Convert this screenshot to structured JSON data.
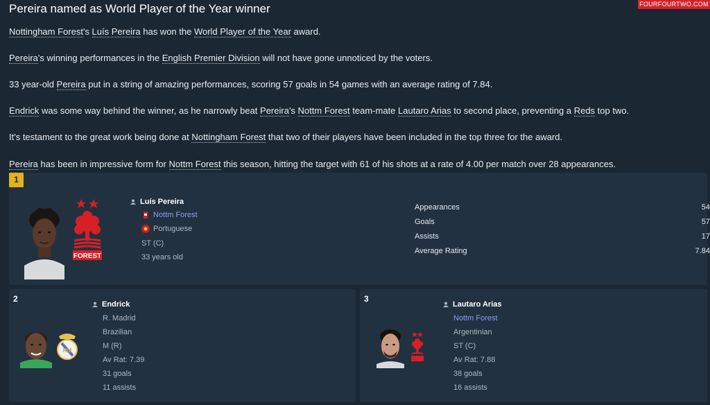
{
  "source": "FOURFOURTWO.COM",
  "headline": "Pereira named as World Player of the Year winner",
  "paragraphs": {
    "p1": {
      "a": "Nottingham Forest",
      "b": "'s ",
      "c": "Luís Pereira",
      "d": " has won the ",
      "e": "World Player of the Year",
      "f": " award."
    },
    "p2": {
      "a": "Pereira",
      "b": "'s winning performances in the ",
      "c": "English Premier Division",
      "d": " will not have gone unnoticed by the voters."
    },
    "p3": {
      "a": "33 year-old ",
      "b": "Pereira",
      "c": " put in a string of amazing performances, scoring 57 goals in 54 games with an average rating of 7.84."
    },
    "p4": {
      "a": "Endrick",
      "b": " was some way behind the winner, as he narrowly beat ",
      "c": "Pereira",
      "d": "'s ",
      "e": "Nottm Forest",
      "f": " team-mate ",
      "g": "Lautaro Arias",
      "h": " to second place, preventing a ",
      "i": "Reds",
      "j": " top two."
    },
    "p5": {
      "a": "It's testament to the great work being done at ",
      "b": "Nottingham Forest",
      "c": " that two of their players have been included in the top three for the award."
    },
    "p6": {
      "a": "Pereira",
      "b": " has been in impressive form for ",
      "c": "Nottm Forest",
      "d": " this season, hitting the target with 61 of his shots at a rate of 4.00 per match over 28 appearances."
    }
  },
  "winner": {
    "rank": "1",
    "name": "Luís Pereira",
    "club": "Nottm Forest",
    "nationality": "Portuguese",
    "position": "ST (C)",
    "age": "33 years old",
    "stats": [
      {
        "label": "Appearances",
        "value": "54"
      },
      {
        "label": "Goals",
        "value": "57"
      },
      {
        "label": "Assists",
        "value": "17"
      },
      {
        "label": "Average Rating",
        "value": "7.84"
      }
    ]
  },
  "second": {
    "rank": "2",
    "name": "Endrick",
    "club": "R. Madrid",
    "nationality": "Brazilian",
    "position": "M (R)",
    "rating": "Av Rat: 7.39",
    "goals": "31 goals",
    "assists": "11 assists"
  },
  "third": {
    "rank": "3",
    "name": "Lautaro Arias",
    "club": "Nottm Forest",
    "nationality": "Argentinian",
    "position": "ST (C)",
    "rating": "Av Rat: 7.88",
    "goals": "38 goals",
    "assists": "16 assists"
  },
  "colors": {
    "background": "#1b2733",
    "card": "#223140",
    "badge_gold": "#e2b21d",
    "link_blue": "#8f9cf5",
    "forest_red": "#d81f26"
  },
  "icons": {
    "person": "person-icon",
    "kit": "shirt-icon",
    "flag": "flag-icon",
    "crest_forest": "nottingham-forest-crest",
    "crest_madrid": "real-madrid-crest"
  }
}
